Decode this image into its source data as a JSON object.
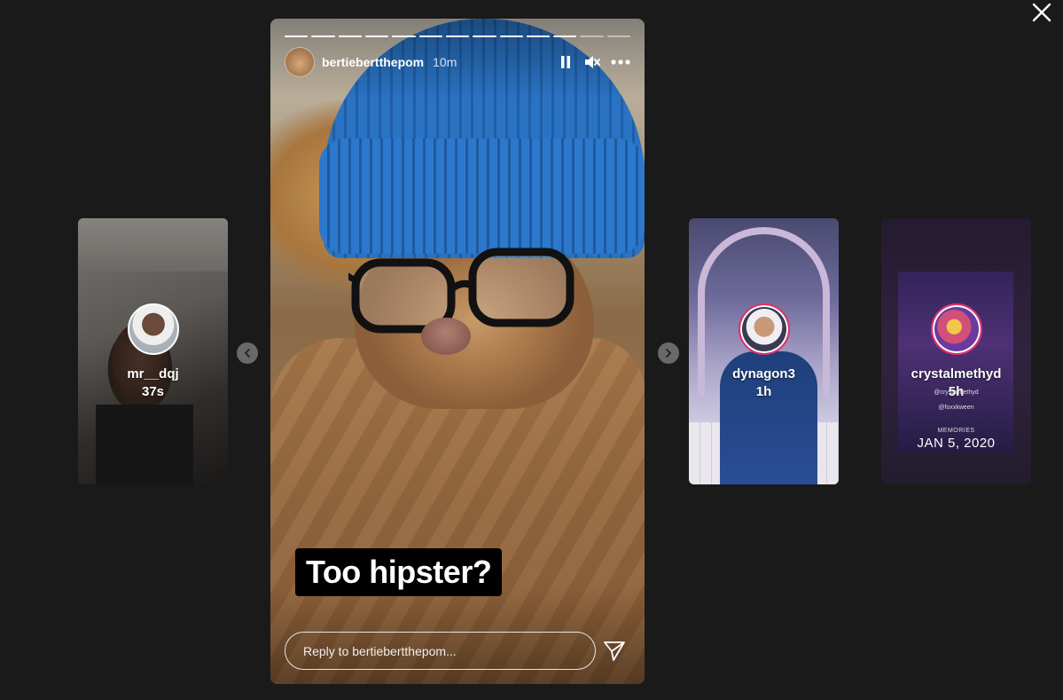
{
  "main_story": {
    "username": "bertiebertthepom",
    "time": "10m",
    "caption": "Too hipster?",
    "reply_placeholder": "Reply to bertiebertthepom...",
    "progress": {
      "total_segments": 13,
      "completed_segments": 11
    }
  },
  "side_stories": [
    {
      "username": "mr__dqj",
      "time": "37s"
    },
    {
      "username": "dynagon3",
      "time": "1h"
    },
    {
      "username": "crystalmethyd",
      "time": "5h",
      "mention_1": "@crystalmethyd",
      "mention_2": "@foxxkween",
      "memories_label": "MEMORIES",
      "memories_date": "JAN 5, 2020"
    }
  ],
  "icons": {
    "close": "close-icon",
    "pause": "pause-icon",
    "mute": "mute-icon",
    "more": "more-icon",
    "send": "send-icon",
    "prev": "chevron-left-icon",
    "next": "chevron-right-icon"
  }
}
